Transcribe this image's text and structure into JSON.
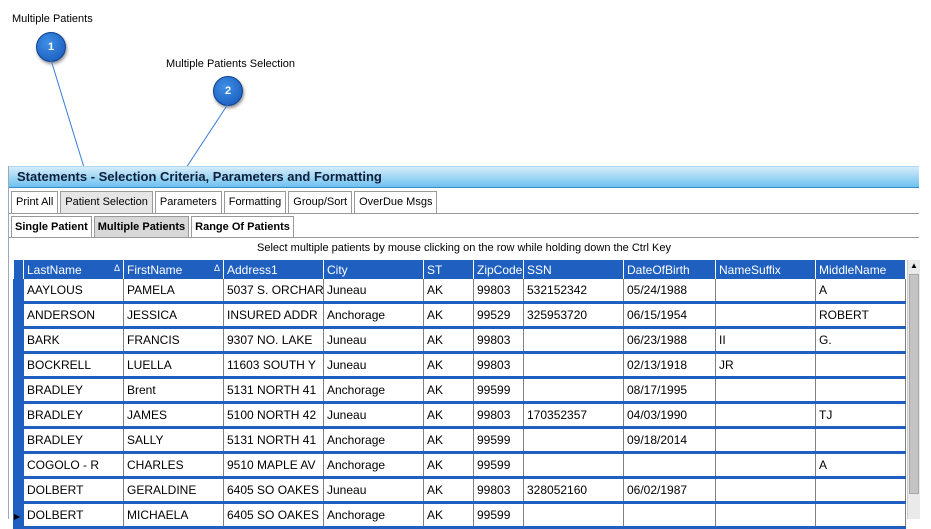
{
  "callouts": [
    {
      "number": "1",
      "label": "Multiple Patients"
    },
    {
      "number": "2",
      "label": "Multiple Patients Selection"
    }
  ],
  "window": {
    "title": "Statements - Selection Criteria, Parameters and Formatting"
  },
  "tabs": [
    "Print All",
    "Patient Selection",
    "Parameters",
    "Formatting",
    "Group/Sort",
    "OverDue Msgs"
  ],
  "active_tab": "Patient Selection",
  "subtabs": [
    "Single Patient",
    "Multiple Patients",
    "Range Of Patients"
  ],
  "active_subtab": "Multiple Patients",
  "instruction": "Select multiple patients by mouse clicking on the row while holding down the Ctrl Key",
  "grid": {
    "columns": [
      "LastName",
      "FirstName",
      "Address1",
      "City",
      "ST",
      "ZipCode",
      "SSN",
      "DateOfBirth",
      "NameSuffix",
      "MiddleName"
    ],
    "sort_indicator": "Δ",
    "rows": [
      [
        "AAYLOUS",
        "PAMELA",
        "5037 S. ORCHAR",
        "Juneau",
        "AK",
        "99803",
        "532152342",
        "05/24/1988",
        "",
        "A"
      ],
      [
        "ANDERSON",
        "JESSICA",
        "INSURED ADDR",
        "Anchorage",
        "AK",
        "99529",
        "325953720",
        "06/15/1954",
        "",
        "ROBERT"
      ],
      [
        "BARK",
        "FRANCIS",
        "9307 NO. LAKE",
        "Juneau",
        "AK",
        "99803",
        "",
        "06/23/1988",
        "II",
        "G."
      ],
      [
        "BOCKRELL",
        "LUELLA",
        "11603 SOUTH Y",
        "Juneau",
        "AK",
        "99803",
        "",
        "02/13/1918",
        "JR",
        ""
      ],
      [
        "BRADLEY",
        "Brent",
        "5131 NORTH 41",
        "Anchorage",
        "AK",
        "99599",
        "",
        "08/17/1995",
        "",
        ""
      ],
      [
        "BRADLEY",
        "JAMES",
        "5100 NORTH 42",
        "Juneau",
        "AK",
        "99803",
        "170352357",
        "04/03/1990",
        "",
        "TJ"
      ],
      [
        "BRADLEY",
        "SALLY",
        "5131 NORTH 41",
        "Anchorage",
        "AK",
        "99599",
        "",
        "09/18/2014",
        "",
        ""
      ],
      [
        "COGOLO - R",
        "CHARLES",
        "9510 MAPLE AV",
        "Anchorage",
        "AK",
        "99599",
        "",
        "",
        "",
        "A"
      ],
      [
        "DOLBERT",
        "GERALDINE",
        "6405 SO OAKES",
        "Juneau",
        "AK",
        "99803",
        "328052160",
        "06/02/1987",
        "",
        ""
      ],
      [
        "DOLBERT",
        "MICHAELA",
        "6405 SO OAKES",
        "Anchorage",
        "AK",
        "99599",
        "",
        "",
        "",
        ""
      ]
    ]
  },
  "colors": {
    "header": "#1f5fbf",
    "title_bar": "#6ec1f0",
    "callout": "#1455b8"
  }
}
